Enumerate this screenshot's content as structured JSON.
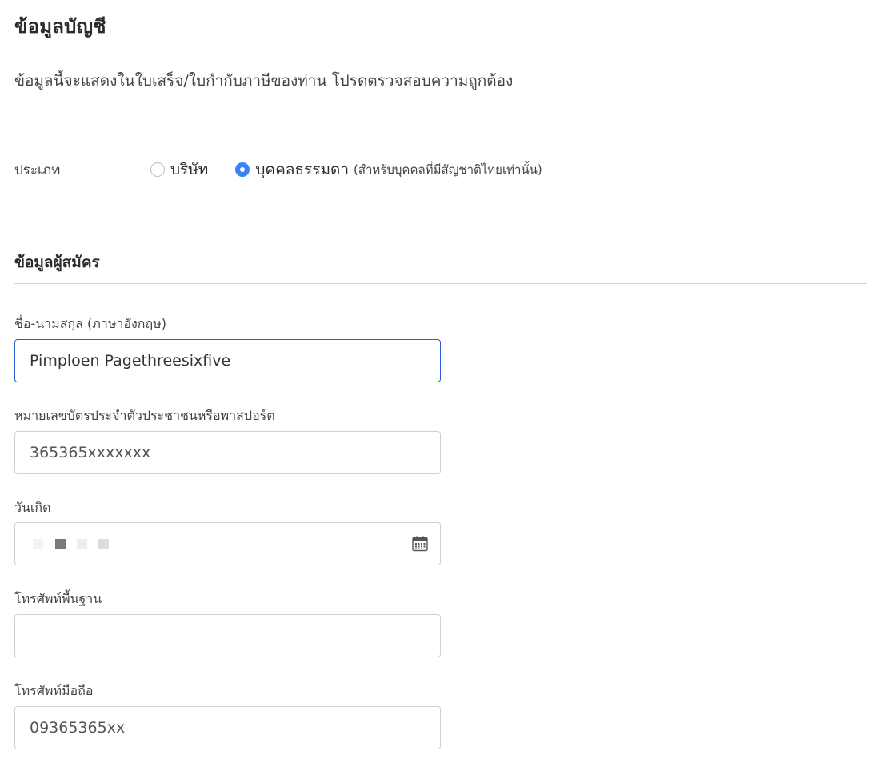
{
  "page": {
    "title": "ข้อมูลบัญชี",
    "description": "ข้อมูลนี้จะแสดงในใบเสร็จ/ใบกำกับภาษีของท่าน โปรดตรวจสอบความถูกต้อง"
  },
  "type": {
    "label": "ประเภท",
    "options": [
      {
        "label": "บริษัท",
        "note": "",
        "checked": false
      },
      {
        "label": "บุคคลธรรมดา",
        "note": "(สำหรับบุคคลที่มีสัญชาติไทยเท่านั้น)",
        "checked": true
      }
    ]
  },
  "applicant": {
    "section_title": "ข้อมูลผู้สมัคร",
    "fields": {
      "name": {
        "label": "ชื่อ-นามสกุล (ภาษาอังกฤษ)",
        "value": "Pimploen Pagethreesixfive"
      },
      "id_card": {
        "label": "หมายเลขบัตรประจำตัวประชาชนหรือพาสปอร์ต",
        "value": "365365xxxxxxx"
      },
      "birthday": {
        "label": "วันเกิด",
        "value": "",
        "icon": "calendar-icon"
      },
      "landline": {
        "label": "โทรศัพท์พื้นฐาน",
        "value": ""
      },
      "mobile": {
        "label": "โทรศัพท์มือถือ",
        "value": "09365365xx"
      }
    }
  },
  "colors": {
    "accent": "#3b82f6",
    "focus_border": "#2b5bd7",
    "input_border": "#d0d0d0"
  }
}
